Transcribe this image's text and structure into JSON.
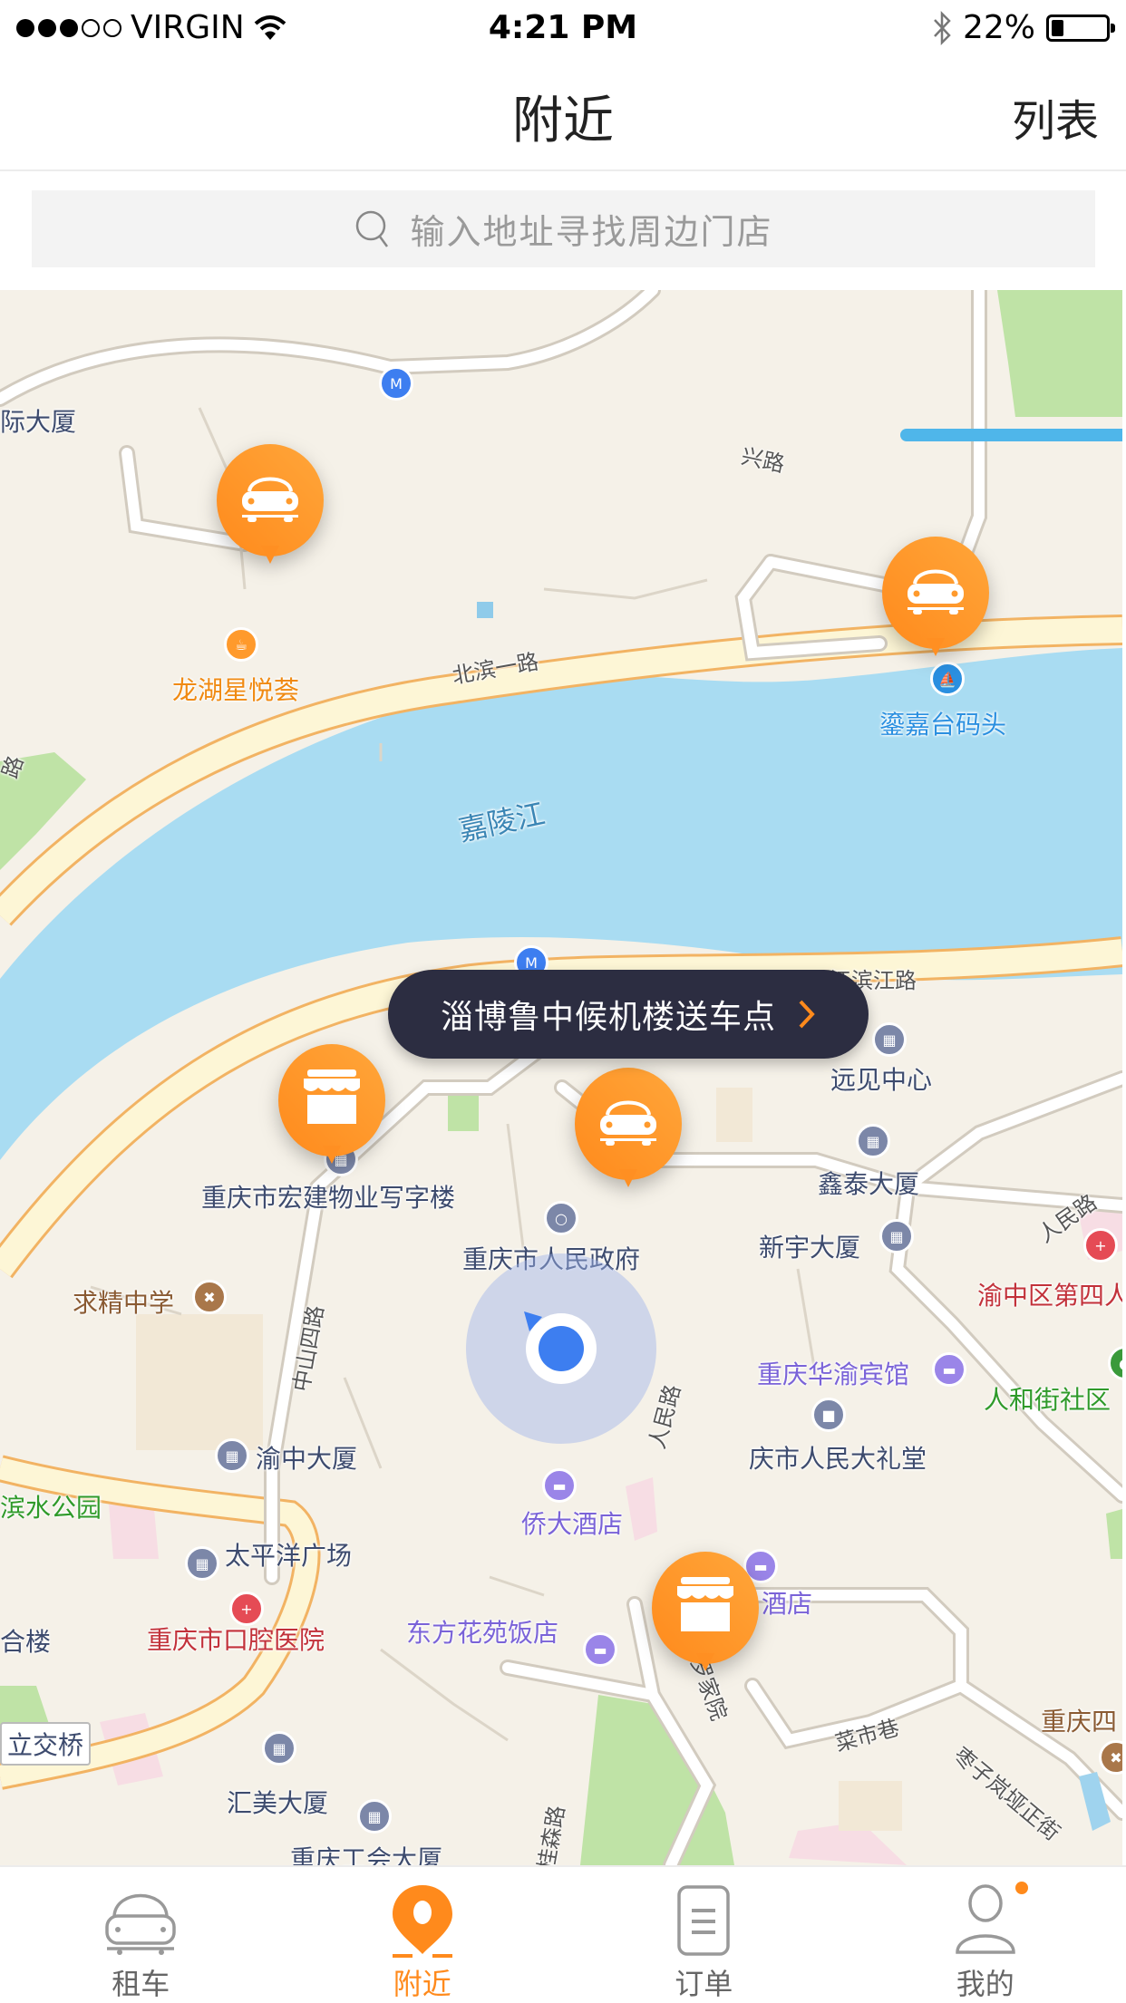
{
  "status_bar": {
    "signal_filled": 3,
    "signal_total": 5,
    "carrier": "VIRGIN",
    "time": "4:21 PM",
    "battery": "22%",
    "battery_level": 0.22
  },
  "nav": {
    "title": "附近",
    "right_button": "列表"
  },
  "search": {
    "placeholder": "输入地址寻找周边门店",
    "value": ""
  },
  "map": {
    "tooltip": "淄博鲁中候机楼送车点",
    "river_label": "嘉陵江",
    "labels": {
      "l1": "际大厦",
      "l2": "兴路",
      "l3": "龙湖星悦荟",
      "l4": "北滨一路",
      "l5": "鎏嘉台码头",
      "l6": "江滨江路",
      "l7": "远见中心",
      "l8": "重庆市宏建物业写字楼",
      "l9": "鑫泰大厦",
      "l10": "重庆市人民政府",
      "l11": "新宇大厦",
      "l12": "求精中学",
      "l13": "人民路",
      "l14": "渝中区第四人",
      "l15": "中山四路",
      "l16": "重庆华渝宾馆",
      "l17": "人和街社区",
      "l18": "人民路",
      "l19": "渝中大厦",
      "l20": "庆市人民大礼堂",
      "l21": "滨水公园",
      "l22": "侨大酒店",
      "l23": "太平洋广场",
      "l24": "酒店",
      "l25": "合楼",
      "l26": "重庆市口腔医院",
      "l27": "东方花苑饭店",
      "l28": "罗家院",
      "l29": "重庆四",
      "l30": "立交桥",
      "l31": "菜市巷",
      "l32": "汇美大厦",
      "l33": "枣子岚垭正街",
      "l34": "重庆工会大厦",
      "l35": "桂森路",
      "l36": "路"
    },
    "markers": [
      {
        "type": "car",
        "icon": "car-icon"
      },
      {
        "type": "car",
        "icon": "car-icon"
      },
      {
        "type": "store",
        "icon": "store-icon"
      },
      {
        "type": "car",
        "icon": "car-icon"
      },
      {
        "type": "store",
        "icon": "store-icon"
      }
    ]
  },
  "tabs": [
    {
      "label": "租车",
      "icon": "car-outline-icon",
      "active": false
    },
    {
      "label": "附近",
      "icon": "location-pin-icon",
      "active": true
    },
    {
      "label": "订单",
      "icon": "order-list-icon",
      "active": false
    },
    {
      "label": "我的",
      "icon": "user-icon",
      "active": false,
      "badge": true
    }
  ],
  "colors": {
    "accent": "#ff8a1c",
    "tooltip_bg": "#2c2d41",
    "location": "#3d7ef0"
  }
}
